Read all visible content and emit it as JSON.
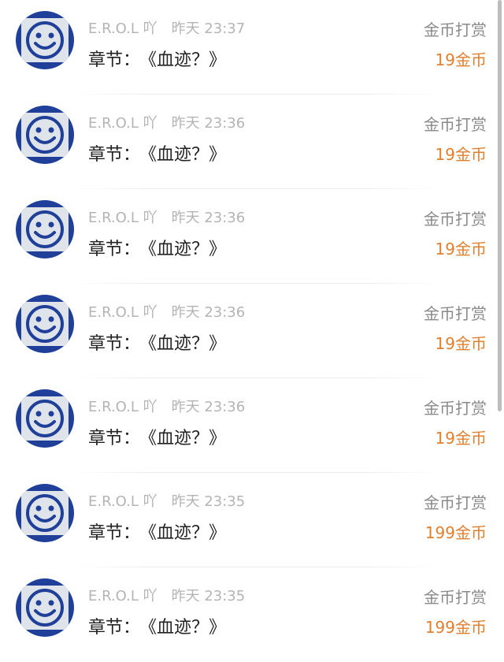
{
  "items": [
    {
      "user": "E.R.O.L 吖",
      "time": "昨天 23:37",
      "chapter_label": "章节：",
      "chapter_title": "《血迹？》",
      "tag": "金币打赏",
      "amount": "19金币"
    },
    {
      "user": "E.R.O.L 吖",
      "time": "昨天 23:36",
      "chapter_label": "章节：",
      "chapter_title": "《血迹？》",
      "tag": "金币打赏",
      "amount": "19金币"
    },
    {
      "user": "E.R.O.L 吖",
      "time": "昨天 23:36",
      "chapter_label": "章节：",
      "chapter_title": "《血迹？》",
      "tag": "金币打赏",
      "amount": "19金币"
    },
    {
      "user": "E.R.O.L 吖",
      "time": "昨天 23:36",
      "chapter_label": "章节：",
      "chapter_title": "《血迹？》",
      "tag": "金币打赏",
      "amount": "19金币"
    },
    {
      "user": "E.R.O.L 吖",
      "time": "昨天 23:36",
      "chapter_label": "章节：",
      "chapter_title": "《血迹？》",
      "tag": "金币打赏",
      "amount": "19金币"
    },
    {
      "user": "E.R.O.L 吖",
      "time": "昨天 23:35",
      "chapter_label": "章节：",
      "chapter_title": "《血迹？》",
      "tag": "金币打赏",
      "amount": "199金币"
    },
    {
      "user": "E.R.O.L 吖",
      "time": "昨天 23:35",
      "chapter_label": "章节：",
      "chapter_title": "《血迹？》",
      "tag": "金币打赏",
      "amount": "199金币"
    }
  ],
  "colors": {
    "amount": "#e0802e",
    "meta": "#b4b4b4",
    "tag": "#8a8a8a",
    "avatar_ring": "#1f3f98"
  },
  "icons": {
    "avatar": "smiley-face-icon"
  }
}
